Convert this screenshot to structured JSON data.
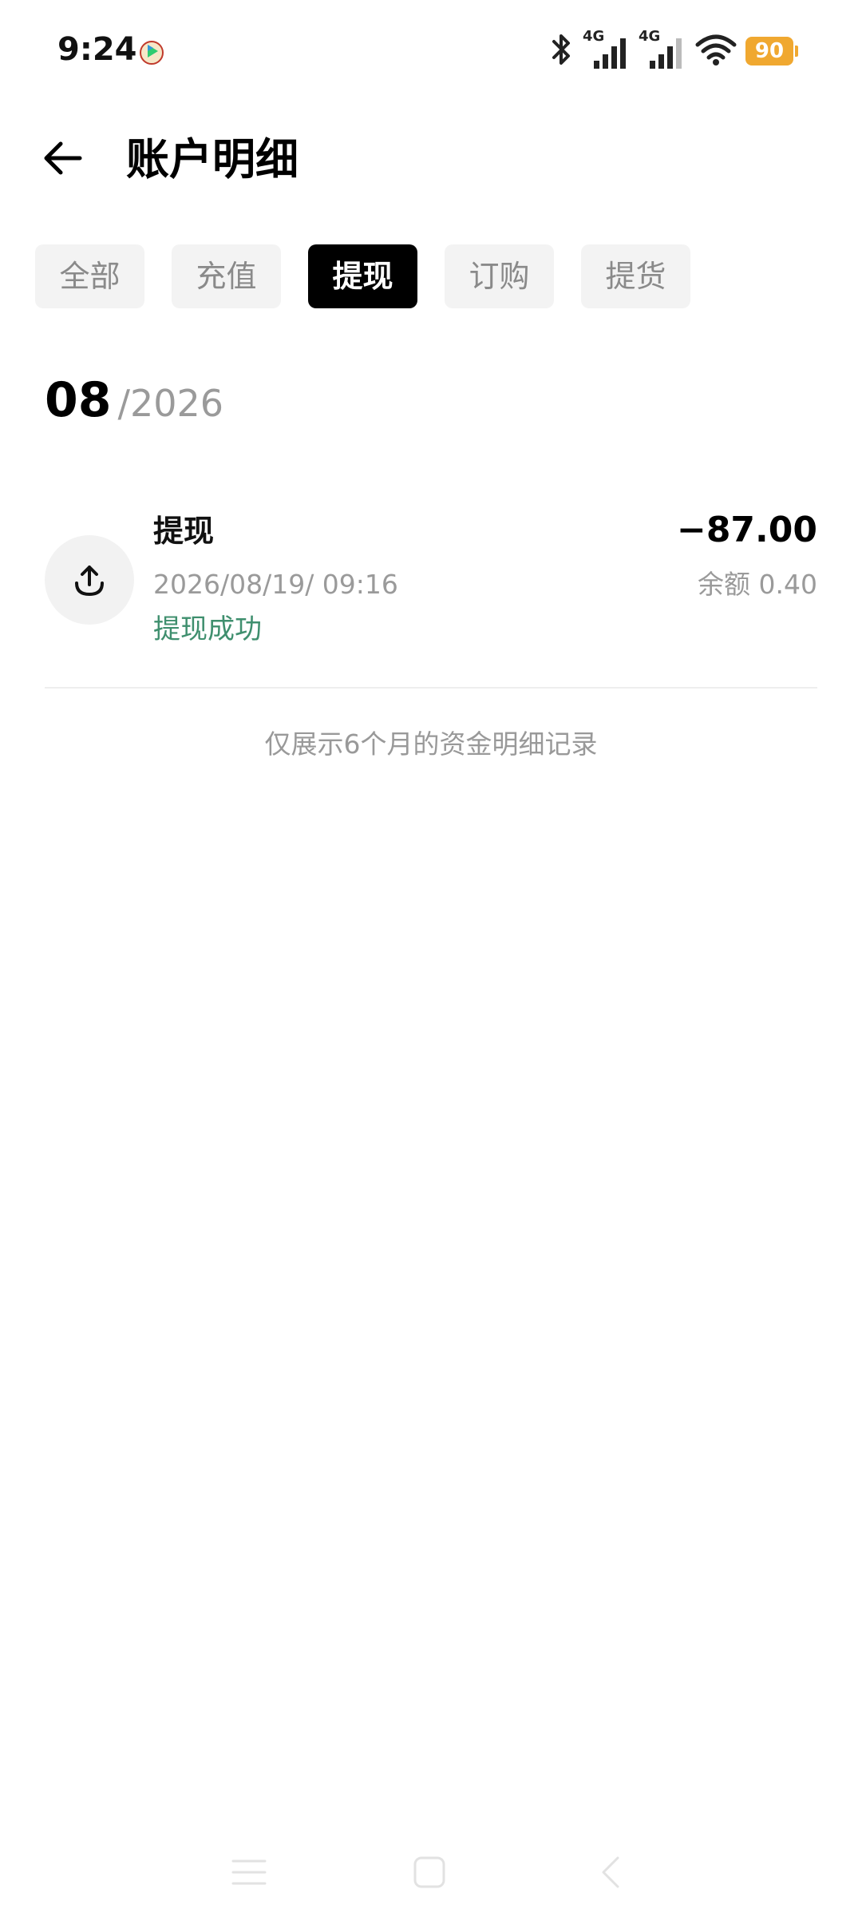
{
  "status_bar": {
    "time": "9:24",
    "signal1_label": "4G",
    "signal2_label": "4G",
    "battery": "90"
  },
  "header": {
    "title": "账户明细"
  },
  "tabs": [
    {
      "label": "全部",
      "active": false
    },
    {
      "label": "充值",
      "active": false
    },
    {
      "label": "提现",
      "active": true
    },
    {
      "label": "订购",
      "active": false
    },
    {
      "label": "提货",
      "active": false
    }
  ],
  "month": {
    "month": "08",
    "year": "/2026"
  },
  "transactions": [
    {
      "title": "提现",
      "time": "2026/08/19/ 09:16",
      "status": "提现成功",
      "amount": "−87.00",
      "balance": "余额 0.40"
    }
  ],
  "footer_note": "仅展示6个月的资金明细记录",
  "colors": {
    "status_success": "#3f8f6e",
    "battery": "#f0a830",
    "active_tab_bg": "#000000"
  },
  "icons": {
    "back": "arrow-left-icon",
    "transaction": "upload-icon",
    "bluetooth": "bluetooth-icon",
    "wifi": "wifi-icon"
  }
}
